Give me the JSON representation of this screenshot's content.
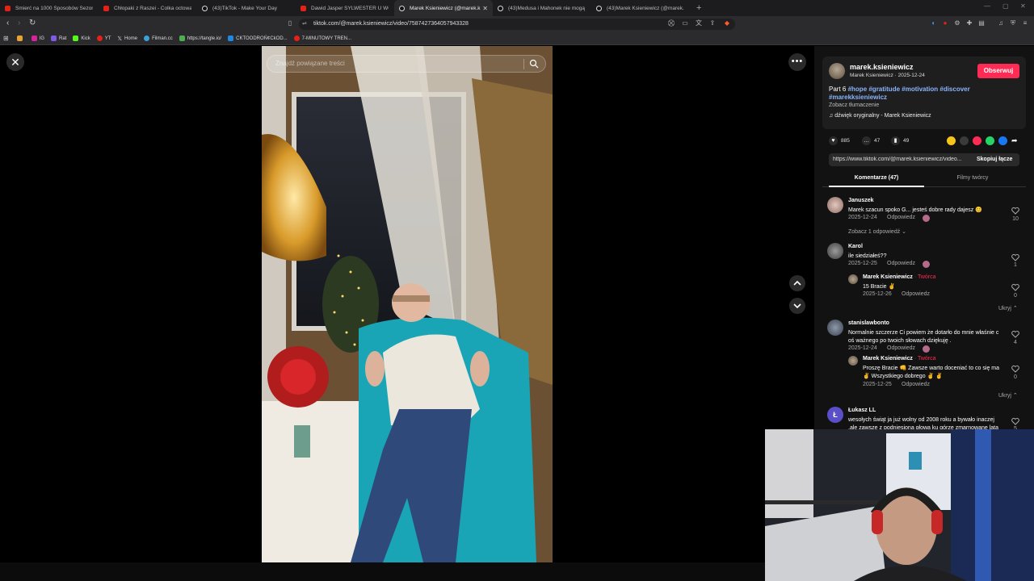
{
  "browser": {
    "tabs": [
      {
        "title": "Śmierć na 1000 Sposobów Sezon 3",
        "type": "yt"
      },
      {
        "title": "Chłopaki z Raszei - Colka octowa",
        "type": "yt"
      },
      {
        "title": "(43)TikTok - Make Your Day",
        "type": "tt"
      },
      {
        "title": "Dawid Jasper SYLWESTER U WÓJCIK",
        "type": "yt"
      },
      {
        "title": "Marek Ksieniewicz (@marek.k",
        "type": "tt",
        "active": true
      },
      {
        "title": "(43)Medusa i Mahonek nie mogą oci",
        "type": "tt"
      },
      {
        "title": "(43)Marek Ksieniewicz (@marek.ksie",
        "type": "tt"
      }
    ],
    "new_tab": "+",
    "url": "tiktok.com/@marek.ksieniewicz/video/7587427364057943328",
    "bookmarks": [
      {
        "label": "",
        "color": "#e6a532"
      },
      {
        "label": "IG",
        "color": "#d6249f"
      },
      {
        "label": "Rat",
        "color": "#7d5be6"
      },
      {
        "label": "Kick",
        "color": "#53fc18"
      },
      {
        "label": "YT",
        "color": "#e62117"
      },
      {
        "label": "Home",
        "color": "#dddddd"
      },
      {
        "label": "Filman.cc",
        "color": "#3aa0d8"
      },
      {
        "label": "https://tangle.io/",
        "color": "#4caf50"
      },
      {
        "label": "CKTOODROŃ¢CkOD...",
        "color": "#1e88e5"
      },
      {
        "label": "7-MINUTOWY TREN...",
        "color": "#e62117"
      }
    ]
  },
  "video": {
    "search_placeholder": "Znajdź powiązane treści"
  },
  "panel": {
    "author_handle": "marek.ksieniewicz",
    "author_sub": "Marek Ksieniewicz · 2025-12-24",
    "follow_label": "Obserwuj",
    "description_prefix": "Part 6 ",
    "hashtags": "#hope #gratitude #motivation #discover #marekksieniewicz",
    "translate_label": "Zobacz tłumaczenie",
    "music_label": "dźwięk oryginalny - Marek Ksieniewicz",
    "likes": "885",
    "comments": "47",
    "saves": "49",
    "link_text": "https://www.tiktok.com/@marek.ksieniewicz/video...",
    "copy_label": "Skopiuj łącze",
    "tab_comments": "Komentarze (47)",
    "tab_creator_videos": "Filmy twórcy"
  },
  "comments": [
    {
      "name": "Januszek",
      "text": "Marek szacun spoko G... jesteś dobre rady dajesz 😊",
      "date": "2025-12-24",
      "reply": "Odpowiedz",
      "likes": "10",
      "more": "Zobacz 1 odpowiedź ⌄"
    },
    {
      "name": "Karol",
      "text": "ile siedziałeś??",
      "date": "2025-12-25",
      "reply": "Odpowiedz",
      "likes": "1"
    },
    {
      "name": "Marek Ksieniewicz",
      "creator": " · Twórca",
      "text": "15 Bracie ✌",
      "date": "2025-12-26",
      "reply": "Odpowiedz",
      "likes": "0",
      "hide": "Ukryj ⌃"
    },
    {
      "name": "stanislawbonto",
      "text1": "Normalnie szczerze Ci powiem że dotarło do mnie właśnie c",
      "text2": "oś ważnego po twoich słowach dziękuję .",
      "date": "2025-12-24",
      "reply": "Odpowiedz",
      "likes": "4"
    },
    {
      "name": "Marek Ksieniewicz",
      "creator": " · Twórca",
      "text1": "Proszę Bracie 👊 Zawsze warto doceniać to co się ma",
      "text2": "✌ Wszystkiego dobrego ✌ ✌",
      "date": "2025-12-25",
      "reply": "Odpowiedz",
      "likes": "0",
      "hide": "Ukryj ⌃"
    },
    {
      "name": "Łukasz LL",
      "avatar_letter": "Ł",
      "text1": "wesołych świąt ja już wolny od 2008 roku a bywało inaczej",
      "text2": ",ale zawsze z podniesioną głową ku górze zmarnowane lata",
      "likes": "5"
    }
  ]
}
